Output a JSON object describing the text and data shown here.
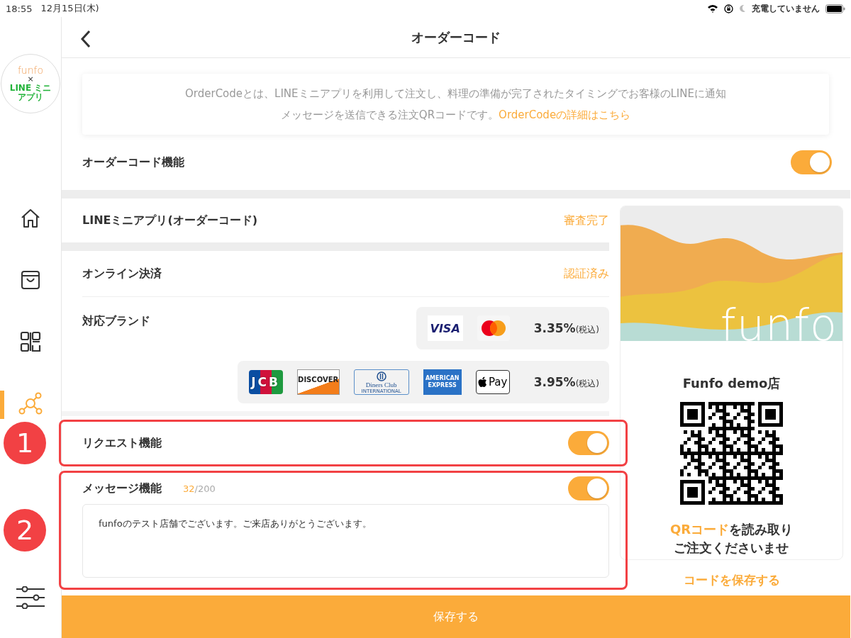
{
  "status_bar": {
    "time": "18:55",
    "date": "12月15日(木)",
    "battery_text": "充電していません"
  },
  "sidebar": {
    "logo": {
      "brand": "funfo",
      "cross": "×",
      "partner": "LINE ミニアプリ"
    },
    "items": [
      {
        "kind": "home",
        "selected": false
      },
      {
        "kind": "store",
        "selected": false
      },
      {
        "kind": "qr",
        "selected": false
      },
      {
        "kind": "share",
        "selected": true
      },
      {
        "kind": "settings",
        "selected": false
      }
    ]
  },
  "header": {
    "title": "オーダーコード"
  },
  "info": {
    "lines": [
      "OrderCodeとは、LINEミニアプリを利用して注文し、料理の準備が完了されたタイミングでお客様のLINEに通知",
      "メッセージを送信できる注文QRコードです。"
    ],
    "link": "OrderCodeの詳細はこちら"
  },
  "order_code": {
    "label": "オーダーコード機能",
    "on": true
  },
  "line_mini_app": {
    "label": "LINEミニアプリ(オーダーコード)",
    "status": "審査完了"
  },
  "online_payment": {
    "label": "オンライン決済",
    "status": "認証済み"
  },
  "brands": {
    "label": "対応ブランド",
    "groups": [
      {
        "rate": "3.35%",
        "tax": "(税込)",
        "logos": [
          {
            "kind": "visa",
            "lines": [
              "VISA"
            ]
          },
          {
            "kind": "mastercard"
          }
        ]
      },
      {
        "rate": "3.95%",
        "tax": "(税込)",
        "logos": [
          {
            "kind": "jcb",
            "lines": [
              "JCB"
            ]
          },
          {
            "kind": "discover",
            "lines": [
              "DISCOVER"
            ]
          },
          {
            "kind": "diners",
            "lines": [
              "Diners Club",
              "INTERNATIONAL"
            ]
          },
          {
            "kind": "amex",
            "lines": [
              "AMERICAN",
              "EXPRESS"
            ]
          },
          {
            "kind": "applepay",
            "lines": [
              "Pay"
            ]
          }
        ]
      }
    ]
  },
  "request": {
    "label": "リクエスト機能",
    "on": true,
    "callout": "1"
  },
  "message": {
    "label": "メッセージ機能",
    "count": "32",
    "max": "/200",
    "on": true,
    "callout": "2",
    "value": "funfoのテスト店舗でございます。ご来店ありがとうございます。"
  },
  "qr_card": {
    "banner_text": "funfo",
    "shop": "Funfo demo店",
    "caption_highlight": "QRコード",
    "caption_rest": "を読み取り",
    "caption_line2": "ご注文くださいませ"
  },
  "save_code": "コードを保存する",
  "save_button": "保存する"
}
